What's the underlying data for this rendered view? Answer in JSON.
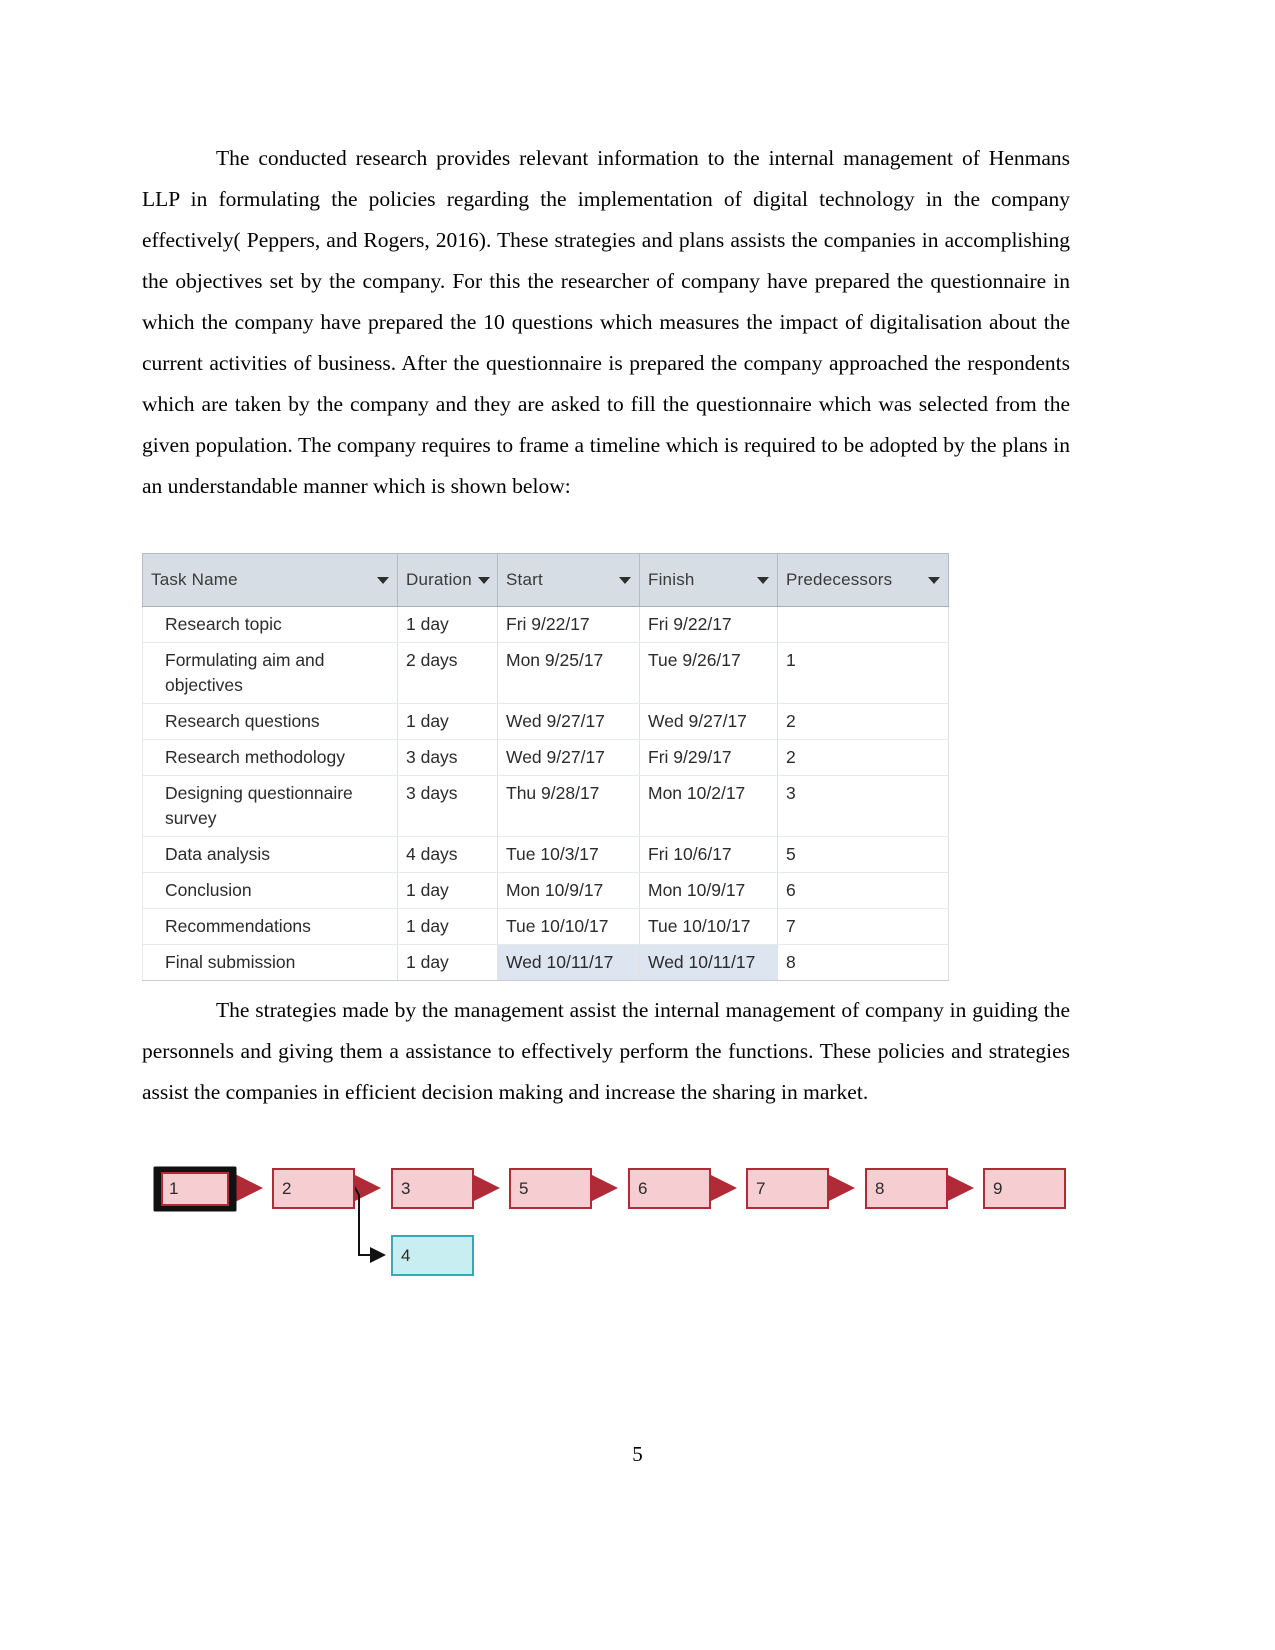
{
  "document": {
    "page_number": "5",
    "paragraph_1": "The conducted research provides relevant information to the internal management of Henmans LLP in formulating the policies regarding the implementation of digital technology in the company effectively( Peppers, and Rogers, 2016). These strategies and plans assists the companies in accomplishing the objectives set by the company. For this the researcher of company have prepared the questionnaire in which the company have prepared the 10 questions which measures the impact of digitalisation about the current activities of business. After the questionnaire is prepared the company approached the respondents which are taken by the company and they are asked to fill the questionnaire which was selected from the given population. The company requires to frame a timeline which is required to be adopted by the plans in an understandable manner which is shown below:",
    "paragraph_2": "The strategies made by the management assist the internal management of company in guiding the personnels and giving them a assistance to effectively perform the functions. These policies and strategies assist the companies in efficient decision making and increase the sharing in market."
  },
  "task_table": {
    "columns": [
      {
        "label": "Task Name",
        "filter_icon": "filter-dropdown-icon"
      },
      {
        "label": "Duration",
        "filter_icon": "filter-dropdown-icon"
      },
      {
        "label": "Start",
        "filter_icon": "filter-dropdown-icon"
      },
      {
        "label": "Finish",
        "filter_icon": "filter-dropdown-icon"
      },
      {
        "label": "Predecessors",
        "filter_icon": "filter-dropdown-icon"
      }
    ],
    "rows": [
      {
        "name": "Research topic",
        "duration": "1 day",
        "start": "Fri 9/22/17",
        "finish": "Fri 9/22/17",
        "predecessors": ""
      },
      {
        "name": "Formulating aim and objectives",
        "duration": "2 days",
        "start": "Mon 9/25/17",
        "finish": "Tue 9/26/17",
        "predecessors": "1"
      },
      {
        "name": "Research questions",
        "duration": "1 day",
        "start": "Wed 9/27/17",
        "finish": "Wed 9/27/17",
        "predecessors": "2"
      },
      {
        "name": "Research methodology",
        "duration": "3 days",
        "start": "Wed 9/27/17",
        "finish": "Fri 9/29/17",
        "predecessors": "2"
      },
      {
        "name": "Designing questionnaire survey",
        "duration": "3 days",
        "start": "Thu 9/28/17",
        "finish": "Mon 10/2/17",
        "predecessors": "3"
      },
      {
        "name": "Data analysis",
        "duration": "4 days",
        "start": "Tue 10/3/17",
        "finish": "Fri 10/6/17",
        "predecessors": "5"
      },
      {
        "name": "Conclusion",
        "duration": "1 day",
        "start": "Mon 10/9/17",
        "finish": "Mon 10/9/17",
        "predecessors": "6"
      },
      {
        "name": "Recommendations",
        "duration": "1 day",
        "start": "Tue 10/10/17",
        "finish": "Tue 10/10/17",
        "predecessors": "7"
      },
      {
        "name": "Final submission",
        "duration": "1 day",
        "start": "Wed 10/11/17",
        "finish": "Wed 10/11/17",
        "predecessors": "8",
        "highlighted": true
      }
    ],
    "colors": {
      "header_background": "#d7dde4",
      "highlight_cell": "#dde5f0",
      "grid_line": "#dfe3e8"
    }
  },
  "network_diagram": {
    "nodes": [
      {
        "id": "n1",
        "label": "1",
        "selected": true,
        "color": "pink"
      },
      {
        "id": "n2",
        "label": "2",
        "selected": false,
        "color": "pink"
      },
      {
        "id": "n3",
        "label": "3",
        "selected": false,
        "color": "pink"
      },
      {
        "id": "n4",
        "label": "4",
        "selected": false,
        "color": "blue"
      },
      {
        "id": "n5",
        "label": "5",
        "selected": false,
        "color": "pink"
      },
      {
        "id": "n6",
        "label": "6",
        "selected": false,
        "color": "pink"
      },
      {
        "id": "n7",
        "label": "7",
        "selected": false,
        "color": "pink"
      },
      {
        "id": "n8",
        "label": "8",
        "selected": false,
        "color": "pink"
      },
      {
        "id": "n9",
        "label": "9",
        "selected": false,
        "color": "pink"
      }
    ],
    "edges": [
      {
        "from": "n1",
        "to": "n2"
      },
      {
        "from": "n2",
        "to": "n3"
      },
      {
        "from": "n2",
        "to": "n4"
      },
      {
        "from": "n3",
        "to": "n5"
      },
      {
        "from": "n5",
        "to": "n6"
      },
      {
        "from": "n6",
        "to": "n7"
      },
      {
        "from": "n7",
        "to": "n8"
      },
      {
        "from": "n8",
        "to": "n9"
      }
    ],
    "colors": {
      "node_fill_pink": "#f6cdd0",
      "node_stroke_pink": "#b02a37",
      "node_fill_blue": "#c8eef2",
      "node_stroke_blue": "#3aa7b5",
      "selection_frame": "#111111"
    }
  }
}
